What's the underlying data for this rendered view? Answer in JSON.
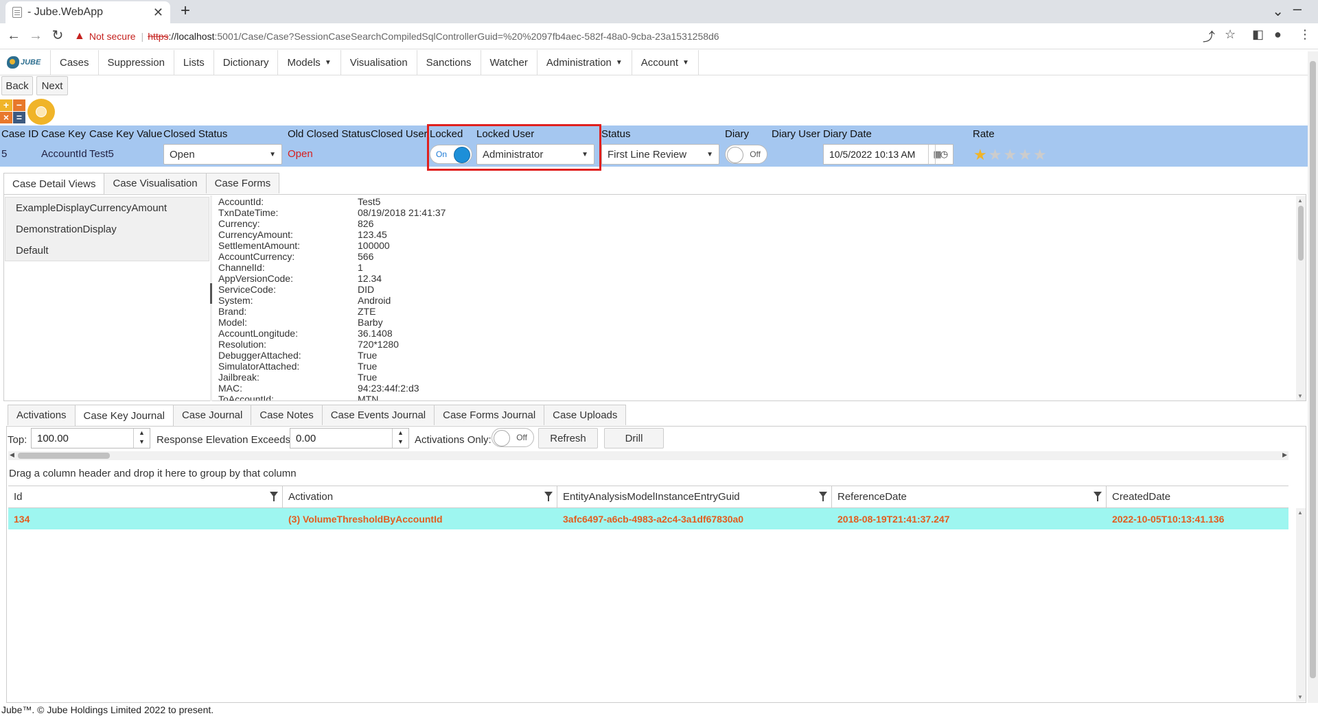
{
  "browser": {
    "tab_title": "- Jube.WebApp",
    "new_tab": "+",
    "close_tab": "✕",
    "address": {
      "warning": "Not secure",
      "scheme": "https",
      "host": "://localhost",
      "path": ":5001/Case/Case?SessionCaseSearchCompiledSqlControllerGuid=%20%2097fb4aec-582f-48a0-9cba-23a1531258d6"
    }
  },
  "nav": {
    "logo_text": "JUBE",
    "items": [
      {
        "label": "Cases",
        "has_menu": false
      },
      {
        "label": "Suppression",
        "has_menu": false
      },
      {
        "label": "Lists",
        "has_menu": false
      },
      {
        "label": "Dictionary",
        "has_menu": false
      },
      {
        "label": "Models",
        "has_menu": true
      },
      {
        "label": "Visualisation",
        "has_menu": false
      },
      {
        "label": "Sanctions",
        "has_menu": false
      },
      {
        "label": "Watcher",
        "has_menu": false
      },
      {
        "label": "Administration",
        "has_menu": true
      },
      {
        "label": "Account",
        "has_menu": true
      }
    ]
  },
  "actions": {
    "back": "Back",
    "next": "Next"
  },
  "case": {
    "labels": {
      "case_id": "Case ID",
      "case_key": "Case Key",
      "case_key_value": "Case Key Value",
      "closed_status": "Closed Status",
      "old_closed_status": "Old Closed Status",
      "closed_user": "Closed User",
      "locked": "Locked",
      "locked_user": "Locked User",
      "status": "Status",
      "diary": "Diary",
      "diary_user": "Diary User",
      "diary_date": "Diary Date",
      "rate": "Rate"
    },
    "values": {
      "case_id": "5",
      "case_key": "AccountId",
      "case_key_value": "Test5",
      "closed_status": "Open",
      "old_closed_status": "Open",
      "locked": "On",
      "locked_user": "Administrator",
      "status": "First Line Review",
      "diary": "Off",
      "diary_date": "10/5/2022 10:13 AM",
      "rating": 1,
      "rating_max": 5
    },
    "colors": {
      "bar": "#a5c7f0",
      "highlight": "#e0201e",
      "star": "#f0b429"
    }
  },
  "detail_tabs": [
    "Case Detail Views",
    "Case Visualisation",
    "Case Forms"
  ],
  "views": [
    "ExampleDisplayCurrencyAmount",
    "DemonstrationDisplay",
    "Default"
  ],
  "details": [
    {
      "k": "AccountId:",
      "v": "Test5"
    },
    {
      "k": "TxnDateTime:",
      "v": "08/19/2018 21:41:37"
    },
    {
      "k": "Currency:",
      "v": "826"
    },
    {
      "k": "CurrencyAmount:",
      "v": "123.45"
    },
    {
      "k": "SettlementAmount:",
      "v": "100000"
    },
    {
      "k": "AccountCurrency:",
      "v": "566"
    },
    {
      "k": "ChannelId:",
      "v": "1"
    },
    {
      "k": "AppVersionCode:",
      "v": "12.34"
    },
    {
      "k": "ServiceCode:",
      "v": "DID"
    },
    {
      "k": "System:",
      "v": "Android"
    },
    {
      "k": "Brand:",
      "v": "ZTE"
    },
    {
      "k": "Model:",
      "v": "Barby"
    },
    {
      "k": "AccountLongitude:",
      "v": "36.1408"
    },
    {
      "k": "Resolution:",
      "v": "720*1280"
    },
    {
      "k": "DebuggerAttached:",
      "v": "True"
    },
    {
      "k": "SimulatorAttached:",
      "v": "True"
    },
    {
      "k": "Jailbreak:",
      "v": "True"
    },
    {
      "k": "MAC:",
      "v": "94:23:44f:2:d3"
    },
    {
      "k": "ToAccountId:",
      "v": "MTN"
    }
  ],
  "journal_tabs": [
    "Activations",
    "Case Key Journal",
    "Case Journal",
    "Case Notes",
    "Case Events Journal",
    "Case Forms Journal",
    "Case Uploads"
  ],
  "journal": {
    "top_label": "Top:",
    "top_value": "100.00",
    "elev_label": "Response Elevation Exceeds:",
    "elev_value": "0.00",
    "activations_label": "Activations Only:",
    "activations_value": "Off",
    "refresh": "Refresh",
    "drill": "Drill",
    "group_hint": "Drag a column header and drop it here to group by that column",
    "columns": [
      "Id",
      "Activation",
      "EntityAnalysisModelInstanceEntryGuid",
      "ReferenceDate",
      "CreatedDate"
    ],
    "rows": [
      [
        "134",
        "(3) VolumeThresholdByAccountId",
        "3afc6497-a6cb-4983-a2c4-3a1df67830a0",
        "2018-08-19T21:41:37.247",
        "2022-10-05T10:13:41.136"
      ]
    ]
  },
  "footer": "Jube™. © Jube Holdings Limited 2022 to present."
}
